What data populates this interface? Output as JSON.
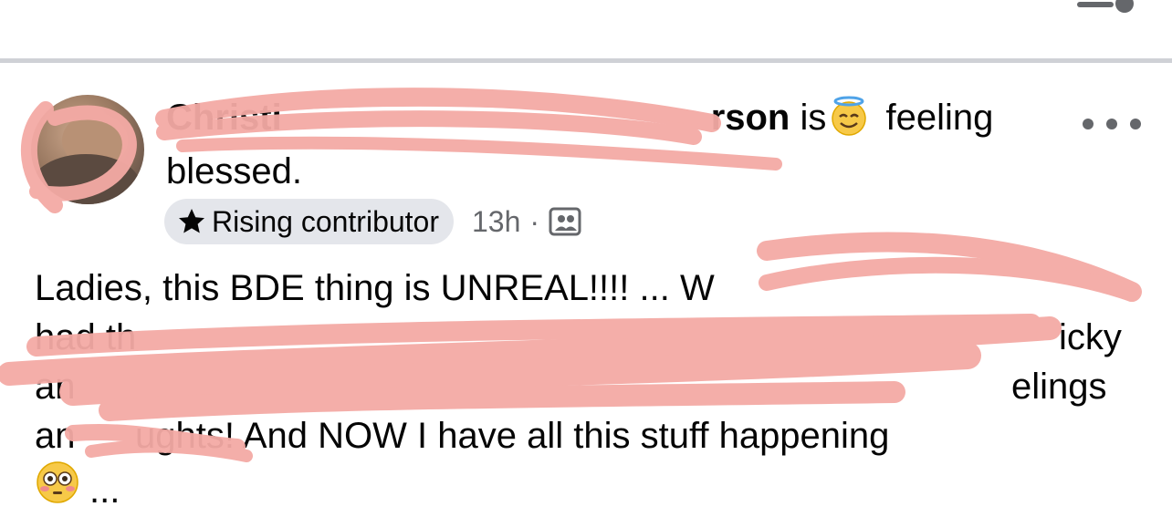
{
  "post": {
    "author_visible_start": "Christi",
    "author_visible_end": "rson",
    "feeling_prefix": "is",
    "feeling_word": "feeling",
    "feeling_line2": "blessed.",
    "feeling_emoji": "smiling-face-with-halo",
    "badge_label": "Rising contributor",
    "time": "13h",
    "separator": "·",
    "audience_icon": "group-members-icon",
    "body_lines": [
      "Ladies, this BDE thing is UNREAL!!!! ... W",
      "had th",
      "icky",
      "an",
      "elings",
      "an",
      "ughts! And NOW I have all this stuff happening",
      "..."
    ],
    "flushed_emoji": "flushed-face"
  },
  "colors": {
    "redaction": "#f4aaa5",
    "badge_bg": "#e4e6eb",
    "secondary_text": "#65676b",
    "divider": "#cfd1d6"
  }
}
